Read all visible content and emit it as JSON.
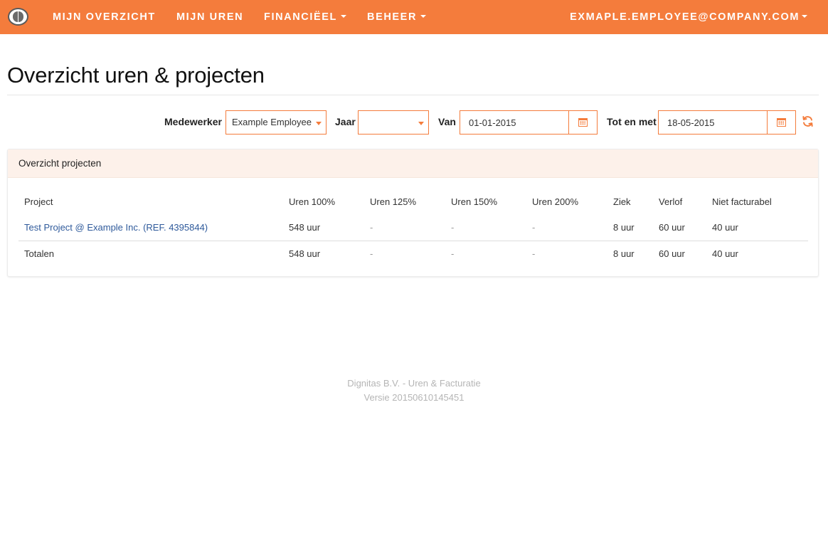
{
  "nav": {
    "items": [
      {
        "label": "MIJN OVERZICHT",
        "dropdown": false
      },
      {
        "label": "MIJN UREN",
        "dropdown": false
      },
      {
        "label": "FINANCIËEL",
        "dropdown": true
      },
      {
        "label": "BEHEER",
        "dropdown": true
      }
    ],
    "user": "EXMAPLE.EMPLOYEE@COMPANY.COM"
  },
  "page": {
    "title": "Overzicht uren & projecten"
  },
  "filters": {
    "employee_label": "Medewerker",
    "employee_value": "Example Employee",
    "year_label": "Jaar",
    "year_value": "",
    "from_label": "Van",
    "from_value": "01-01-2015",
    "to_label": "Tot en met",
    "to_value": "18-05-2015"
  },
  "panel": {
    "title": "Overzicht projecten",
    "columns": [
      "Project",
      "Uren 100%",
      "Uren 125%",
      "Uren 150%",
      "Uren 200%",
      "Ziek",
      "Verlof",
      "Niet facturabel"
    ],
    "rows": [
      [
        "Test Project @ Example Inc. (REF. 4395844)",
        "548 uur",
        "-",
        "-",
        "-",
        "8 uur",
        "60 uur",
        "40 uur"
      ]
    ],
    "totals": [
      "Totalen",
      "548 uur",
      "-",
      "-",
      "-",
      "8 uur",
      "60 uur",
      "40 uur"
    ]
  },
  "footer": {
    "line1": "Dignitas B.V. - Uren & Facturatie",
    "line2": "Versie 20150610145451"
  },
  "colors": {
    "accent": "#f47c3c",
    "link": "#2f5a9b",
    "panel_heading_bg": "#fdf1ea"
  },
  "icons": [
    "logo",
    "caret-down-icon",
    "calendar-icon",
    "refresh-icon"
  ]
}
